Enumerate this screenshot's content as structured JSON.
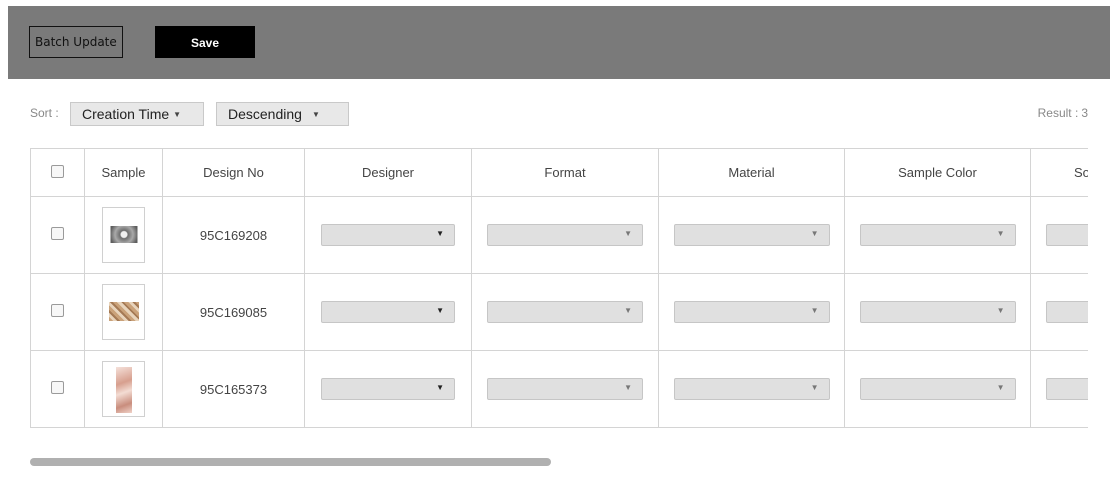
{
  "toolbar": {
    "batch_update_label": "Batch Update",
    "save_label": "Save"
  },
  "sort": {
    "label": "Sort :",
    "field": "Creation Time",
    "order": "Descending"
  },
  "result": {
    "label": "Result :",
    "count": "3"
  },
  "table": {
    "headers": [
      "",
      "Sample",
      "Design No",
      "Designer",
      "Format",
      "Material",
      "Sample Color",
      "So"
    ],
    "rows": [
      {
        "design_no": "95C169208",
        "sample": "grey-radial-sample"
      },
      {
        "design_no": "95C169085",
        "sample": "beige-pattern-sample"
      },
      {
        "design_no": "95C165373",
        "sample": "pink-marble-sample"
      }
    ]
  },
  "icons": {
    "dropdown": "caret-down-icon",
    "checkbox": "checkbox-icon"
  },
  "colors": {
    "toolbar_bg": "#7a7a7a",
    "save_bg": "#000000",
    "select_bg": "#e0e0e0"
  }
}
